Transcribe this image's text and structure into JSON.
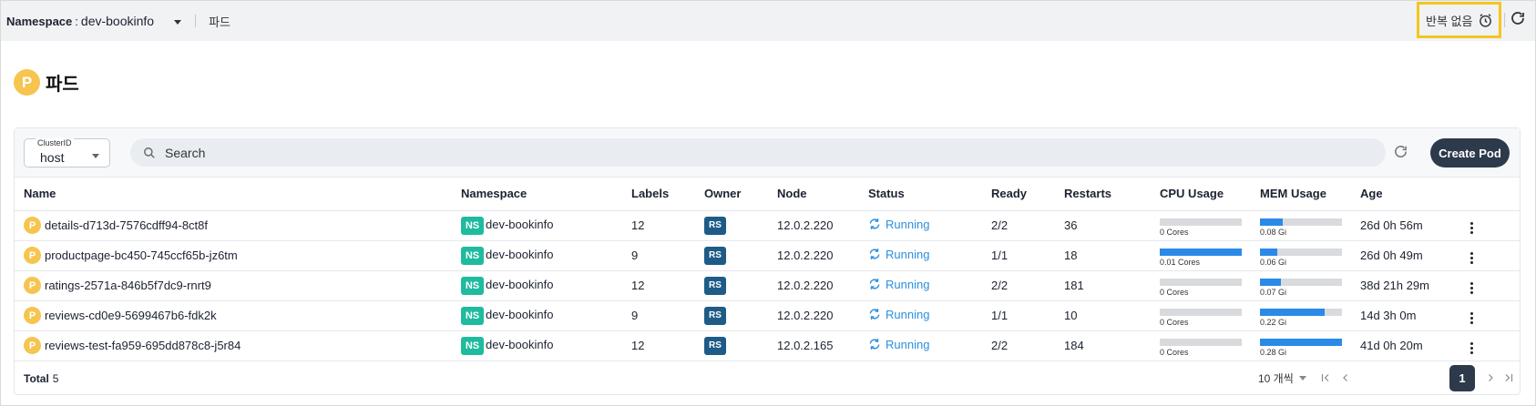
{
  "topbar": {
    "namespace_label": "Namespace",
    "namespace_colon": ":",
    "namespace_value": "dev-bookinfo",
    "breadcrumb": "파드",
    "refresh_interval": "반복 없음",
    "highlight_color": "#f2c61f"
  },
  "page": {
    "badge": "P",
    "title": "파드"
  },
  "toolbar": {
    "cluster_legend": "ClusterID",
    "cluster_value": "host",
    "search_placeholder": "Search",
    "create_label": "Create Pod"
  },
  "table": {
    "headers": [
      "Name",
      "Namespace",
      "Labels",
      "Owner",
      "Node",
      "Status",
      "Ready",
      "Restarts",
      "CPU Usage",
      "MEM Usage",
      "Age"
    ],
    "rows": [
      {
        "icon": "P",
        "name": "details-d713d-7576cdff94-8ct8f",
        "ns_badge": "NS",
        "namespace": "dev-bookinfo",
        "labels": "12",
        "owner": "RS",
        "node": "12.0.2.220",
        "status": "Running",
        "ready": "2/2",
        "restarts": "36",
        "cpu_label": "0 Cores",
        "cpu_fraction": 0.0,
        "mem_label": "0.08 Gi",
        "mem_fraction": 0.28,
        "age": "26d 0h 56m"
      },
      {
        "icon": "P",
        "name": "productpage-bc450-745ccf65b-jz6tm",
        "ns_badge": "NS",
        "namespace": "dev-bookinfo",
        "labels": "9",
        "owner": "RS",
        "node": "12.0.2.220",
        "status": "Running",
        "ready": "1/1",
        "restarts": "18",
        "cpu_label": "0.01 Cores",
        "cpu_fraction": 1.0,
        "mem_label": "0.06 Gi",
        "mem_fraction": 0.21,
        "age": "26d 0h 49m"
      },
      {
        "icon": "P",
        "name": "ratings-2571a-846b5f7dc9-rnrt9",
        "ns_badge": "NS",
        "namespace": "dev-bookinfo",
        "labels": "12",
        "owner": "RS",
        "node": "12.0.2.220",
        "status": "Running",
        "ready": "2/2",
        "restarts": "181",
        "cpu_label": "0 Cores",
        "cpu_fraction": 0.0,
        "mem_label": "0.07 Gi",
        "mem_fraction": 0.25,
        "age": "38d 21h 29m"
      },
      {
        "icon": "P",
        "name": "reviews-cd0e9-5699467b6-fdk2k",
        "ns_badge": "NS",
        "namespace": "dev-bookinfo",
        "labels": "9",
        "owner": "RS",
        "node": "12.0.2.220",
        "status": "Running",
        "ready": "1/1",
        "restarts": "10",
        "cpu_label": "0 Cores",
        "cpu_fraction": 0.0,
        "mem_label": "0.22 Gi",
        "mem_fraction": 0.79,
        "age": "14d 3h 0m"
      },
      {
        "icon": "P",
        "name": "reviews-test-fa959-695dd878c8-j5r84",
        "ns_badge": "NS",
        "namespace": "dev-bookinfo",
        "labels": "12",
        "owner": "RS",
        "node": "12.0.2.165",
        "status": "Running",
        "ready": "2/2",
        "restarts": "184",
        "cpu_label": "0 Cores",
        "cpu_fraction": 0.0,
        "mem_label": "0.28 Gi",
        "mem_fraction": 1.0,
        "age": "41d 0h 20m"
      }
    ]
  },
  "footer": {
    "total_label": "Total",
    "total_value": "5",
    "per_page": "10 개씩",
    "current_page": "1"
  },
  "colors": {
    "pod_badge": "#f5c550",
    "ns_badge": "#1fbb9f",
    "rs_badge": "#1e5b87",
    "running": "#2b8fde",
    "usage_fill": "#2b8ae8",
    "primary_button": "#2d3a4b"
  },
  "icons": {
    "alarm": "alarm-clock-icon",
    "refresh": "refresh-icon",
    "search": "search-icon",
    "status": "sync-icon",
    "row_menu": "more-vertical-icon",
    "first": "first-page-icon",
    "prev": "prev-page-icon",
    "next": "next-page-icon",
    "last": "last-page-icon"
  }
}
